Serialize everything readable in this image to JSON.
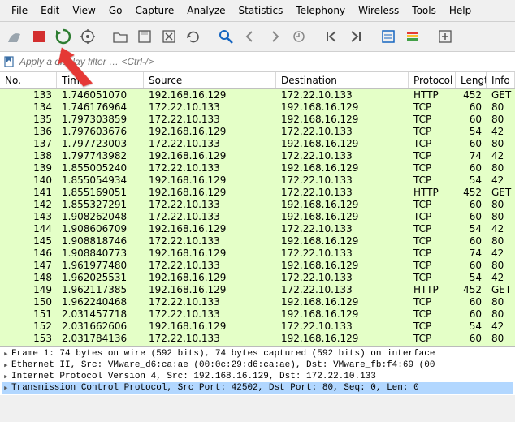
{
  "menubar": {
    "items": [
      {
        "accel": "F",
        "rest": "ile"
      },
      {
        "accel": "E",
        "rest": "dit"
      },
      {
        "accel": "V",
        "rest": "iew"
      },
      {
        "accel": "G",
        "rest": "o"
      },
      {
        "accel": "C",
        "rest": "apture"
      },
      {
        "accel": "A",
        "rest": "nalyze"
      },
      {
        "accel": "S",
        "rest": "tatistics"
      },
      {
        "accel": "",
        "rest": "Telephon",
        "accel2": "y"
      },
      {
        "accel": "W",
        "rest": "ireless"
      },
      {
        "accel": "T",
        "rest": "ools"
      },
      {
        "accel": "H",
        "rest": "elp"
      }
    ]
  },
  "toolbar": {
    "icons": [
      "shark-fin-icon",
      "stop-capture-icon",
      "restart-capture-icon",
      "capture-options-icon",
      "sep",
      "open-icon",
      "save-icon",
      "close-file-icon",
      "reload-icon",
      "sep",
      "find-icon",
      "go-back-icon",
      "go-forward-icon",
      "jump-icon",
      "sep",
      "go-first-icon",
      "go-last-icon",
      "sep",
      "auto-scroll-icon",
      "colorize-icon",
      "sep",
      "zoom-in-icon"
    ]
  },
  "filter": {
    "placeholder": "Apply a display filter … <Ctrl-/>"
  },
  "columns": {
    "no": "No.",
    "time": "Time",
    "src": "Source",
    "dst": "Destination",
    "proto": "Protocol",
    "len": "Length",
    "info": "Info"
  },
  "packets": [
    {
      "no": 133,
      "time": "1.746051070",
      "src": "192.168.16.129",
      "dst": "172.22.10.133",
      "proto": "HTTP",
      "len": 452,
      "info": "GET"
    },
    {
      "no": 134,
      "time": "1.746176964",
      "src": "172.22.10.133",
      "dst": "192.168.16.129",
      "proto": "TCP",
      "len": 60,
      "info": "80"
    },
    {
      "no": 135,
      "time": "1.797303859",
      "src": "172.22.10.133",
      "dst": "192.168.16.129",
      "proto": "TCP",
      "len": 60,
      "info": "80"
    },
    {
      "no": 136,
      "time": "1.797603676",
      "src": "192.168.16.129",
      "dst": "172.22.10.133",
      "proto": "TCP",
      "len": 54,
      "info": "42"
    },
    {
      "no": 137,
      "time": "1.797723003",
      "src": "172.22.10.133",
      "dst": "192.168.16.129",
      "proto": "TCP",
      "len": 60,
      "info": "80"
    },
    {
      "no": 138,
      "time": "1.797743982",
      "src": "192.168.16.129",
      "dst": "172.22.10.133",
      "proto": "TCP",
      "len": 74,
      "info": "42"
    },
    {
      "no": 139,
      "time": "1.855005240",
      "src": "172.22.10.133",
      "dst": "192.168.16.129",
      "proto": "TCP",
      "len": 60,
      "info": "80"
    },
    {
      "no": 140,
      "time": "1.855054934",
      "src": "192.168.16.129",
      "dst": "172.22.10.133",
      "proto": "TCP",
      "len": 54,
      "info": "42"
    },
    {
      "no": 141,
      "time": "1.855169051",
      "src": "192.168.16.129",
      "dst": "172.22.10.133",
      "proto": "HTTP",
      "len": 452,
      "info": "GET"
    },
    {
      "no": 142,
      "time": "1.855327291",
      "src": "172.22.10.133",
      "dst": "192.168.16.129",
      "proto": "TCP",
      "len": 60,
      "info": "80"
    },
    {
      "no": 143,
      "time": "1.908262048",
      "src": "172.22.10.133",
      "dst": "192.168.16.129",
      "proto": "TCP",
      "len": 60,
      "info": "80"
    },
    {
      "no": 144,
      "time": "1.908606709",
      "src": "192.168.16.129",
      "dst": "172.22.10.133",
      "proto": "TCP",
      "len": 54,
      "info": "42"
    },
    {
      "no": 145,
      "time": "1.908818746",
      "src": "172.22.10.133",
      "dst": "192.168.16.129",
      "proto": "TCP",
      "len": 60,
      "info": "80"
    },
    {
      "no": 146,
      "time": "1.908840773",
      "src": "192.168.16.129",
      "dst": "172.22.10.133",
      "proto": "TCP",
      "len": 74,
      "info": "42"
    },
    {
      "no": 147,
      "time": "1.961977480",
      "src": "172.22.10.133",
      "dst": "192.168.16.129",
      "proto": "TCP",
      "len": 60,
      "info": "80"
    },
    {
      "no": 148,
      "time": "1.962025531",
      "src": "192.168.16.129",
      "dst": "172.22.10.133",
      "proto": "TCP",
      "len": 54,
      "info": "42"
    },
    {
      "no": 149,
      "time": "1.962117385",
      "src": "192.168.16.129",
      "dst": "172.22.10.133",
      "proto": "HTTP",
      "len": 452,
      "info": "GET"
    },
    {
      "no": 150,
      "time": "1.962240468",
      "src": "172.22.10.133",
      "dst": "192.168.16.129",
      "proto": "TCP",
      "len": 60,
      "info": "80"
    },
    {
      "no": 151,
      "time": "2.031457718",
      "src": "172.22.10.133",
      "dst": "192.168.16.129",
      "proto": "TCP",
      "len": 60,
      "info": "80"
    },
    {
      "no": 152,
      "time": "2.031662606",
      "src": "192.168.16.129",
      "dst": "172.22.10.133",
      "proto": "TCP",
      "len": 54,
      "info": "42"
    },
    {
      "no": 153,
      "time": "2.031784136",
      "src": "172.22.10.133",
      "dst": "192.168.16.129",
      "proto": "TCP",
      "len": 60,
      "info": "80"
    }
  ],
  "details": {
    "line0": "Frame 1: 74 bytes on wire (592 bits), 74 bytes captured (592 bits) on interface",
    "line1": "Ethernet II, Src: VMware_d6:ca:ae (00:0c:29:d6:ca:ae), Dst: VMware_fb:f4:69 (00",
    "line2": "Internet Protocol Version 4, Src: 192.168.16.129, Dst: 172.22.10.133",
    "line3": "Transmission Control Protocol, Src Port: 42502, Dst Port: 80, Seq: 0, Len: 0"
  }
}
